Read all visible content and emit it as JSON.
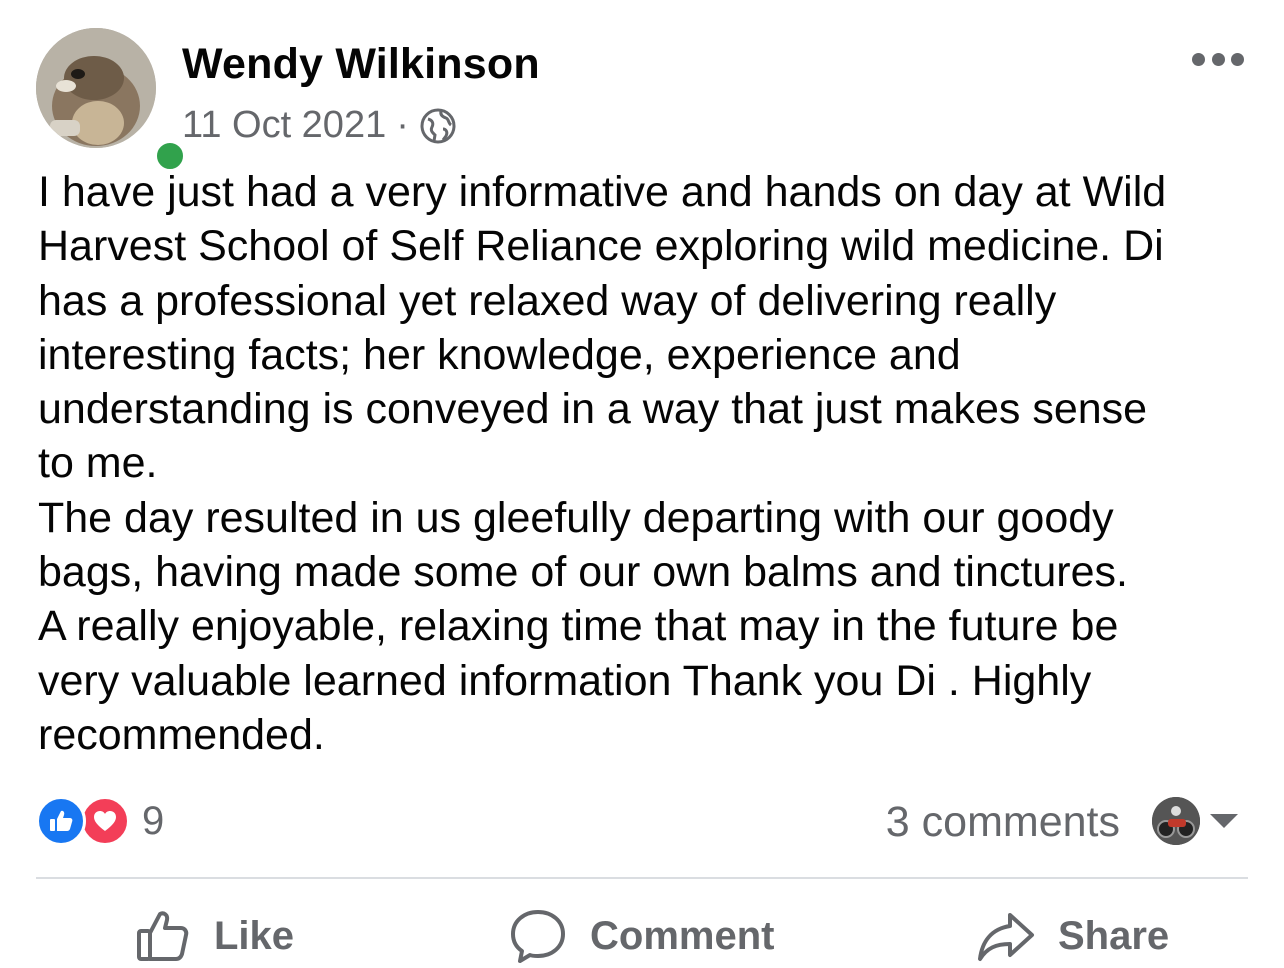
{
  "post": {
    "author": "Wendy Wilkinson",
    "date": "11 Oct 2021",
    "separator": "·",
    "privacy_icon": "globe-icon",
    "online": true,
    "body": "I have just had a very informative and hands on day at Wild\nHarvest School of Self Reliance exploring wild medicine. Di\nhas a professional yet relaxed way of delivering really\ninteresting facts; her knowledge, experience and\nunderstanding is conveyed in a way that just makes sense\nto me.\nThe day resulted in us gleefully departing with our goody\nbags,  having made some of our own balms and tinctures.\nA really enjoyable, relaxing time that may in the future be\nvery valuable learned information Thank you Di . Highly\nrecommended."
  },
  "stats": {
    "reaction_icons": [
      "like-reaction-icon",
      "love-reaction-icon"
    ],
    "reaction_count": "9",
    "comments": "3 comments"
  },
  "actions": {
    "like": "Like",
    "comment": "Comment",
    "share": "Share"
  },
  "colors": {
    "like_blue": "#1877f2",
    "love_red": "#f33e58",
    "online_green": "#31a24c",
    "secondary_text": "#65676b",
    "divider": "#dadde1"
  }
}
